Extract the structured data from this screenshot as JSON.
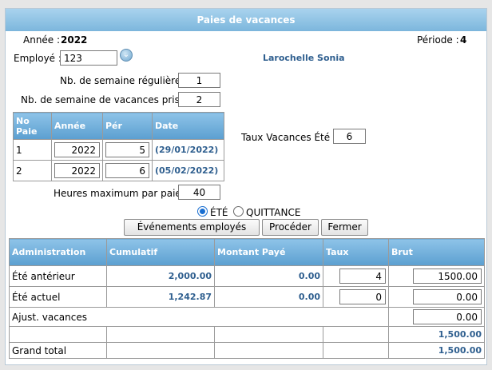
{
  "window": {
    "title": "Paies de vacances"
  },
  "header": {
    "year_label": "Année :",
    "year_value": "2022",
    "period_label": "Période :",
    "period_value": "4",
    "employee_label": "Employé :",
    "employee_value": "123",
    "employee_name": "Larochelle Sonia"
  },
  "fields": {
    "regular_weeks_label": "Nb. de semaine régulière :",
    "regular_weeks_value": "1",
    "vacation_weeks_label": "Nb. de semaine de vacances prise :",
    "vacation_weeks_value": "2",
    "summer_rate_label": "Taux Vacances Été :",
    "summer_rate_value": "6",
    "max_hours_label": "Heures maximum par paie :",
    "max_hours_value": "40"
  },
  "pay_table": {
    "headers": [
      "No Paie",
      "Année",
      "Pér",
      "Date"
    ],
    "rows": [
      {
        "no": "1",
        "year": "2022",
        "period": "5",
        "date": "(29/01/2022)"
      },
      {
        "no": "2",
        "year": "2022",
        "period": "6",
        "date": "(05/02/2022)"
      }
    ]
  },
  "radios": {
    "summer_label": "ÉTÉ",
    "summer_checked": true,
    "receipt_label": "QUITTANCE",
    "receipt_checked": false
  },
  "buttons": {
    "events": "Événements employés",
    "proceed": "Procéder",
    "close": "Fermer"
  },
  "summary_table": {
    "headers": [
      "Administration",
      "Cumulatif",
      "Montant Payé",
      "Taux",
      "Brut"
    ],
    "rows": [
      {
        "label": "Été antérieur",
        "cumulative": "2,000.00",
        "paid": "0.00",
        "rate": "4",
        "gross": "1500.00"
      },
      {
        "label": "Été actuel",
        "cumulative": "1,242.87",
        "paid": "0.00",
        "rate": "0",
        "gross": "0.00"
      }
    ],
    "adjust_label": "Ajust. vacances",
    "adjust_value": "0.00",
    "subtotal": "1,500.00",
    "grand_total_label": "Grand total",
    "grand_total": "1,500.00"
  },
  "colors": {
    "title_gradient_top": "#a9d3ee",
    "header_blue": "#5b9fd0",
    "value_blue": "#2f5f8f"
  }
}
